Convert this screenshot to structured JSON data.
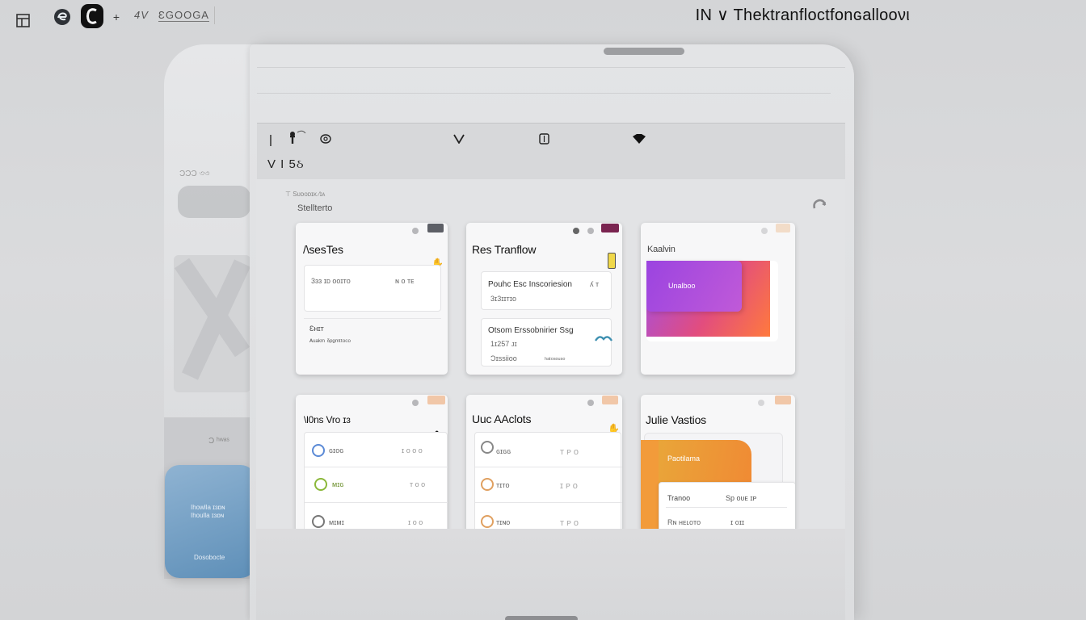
{
  "topbar": {
    "icons": [
      "grid-app-icon",
      "edge-browser-icon",
      "c-logo-icon",
      "add-icon",
      "signal-icon"
    ],
    "status_text": "4V",
    "status_code": "ƐGOOGA",
    "title": "IN ∨ Thektranfloctfonɢallooνι"
  },
  "ghost": {
    "label1": "ƆƆƆ ৩৩",
    "label2": "Ɔ  ʰʷᵃˢ",
    "blue_line1": "Ihowlla ɪɜɒɴ",
    "blue_line2": "Ihoulla ɪɜɒɴ",
    "blue_footer": "Dosobocte"
  },
  "toolbar": {
    "icons": [
      "menu-icon",
      "pin-icon",
      "at-icon",
      "chevron-down-icon",
      "archive-icon",
      "diamond-icon"
    ],
    "view_label": "V I 5ઠ"
  },
  "breadcrumb": "⊤ Sᴜᴅᴏᴅɪᴋ ⁄ɪᴀ",
  "section_title": "Stellterto",
  "cards": [
    {
      "title": "/\\sesTes",
      "tag_color": "#5d5f66",
      "rows": [
        "3ɜɜ ɪᴅ ᴏᴏɪᴛᴏ",
        "ɴ  ᴏ ᴛᴇ"
      ],
      "sub_label": "Ɛʜɪᴛ",
      "sub_text": "ᴬᵘᵃᵏᵐ ᵟᵖᵍᵐᵗᵗᵒᶜᵒ"
    },
    {
      "title": "Res Tranflow",
      "tag_color": "#7a2450",
      "panel1_title": "Pouhc Esc Inscoriesion",
      "panel1_val": "3ɪ3ɪɪᴛɪᴏ",
      "panel1_side": "ʎ  ᴛ",
      "panel2_title": "Otsom Erssobnirier Ssg",
      "panel2_val": "1ɪ257  ᴊɪ",
      "panel2_foot": "Ɔɪssiioᴏ",
      "panel2_side": "ʰᵃᵗᵒˢᵒᵘˢᵒ"
    },
    {
      "title": "Kaalvin",
      "tag_color": "#f2dcc8",
      "chip_label": "Unalboo"
    },
    {
      "title": "\\l0ns Vro ɪɜ",
      "tag_color": "#f1c7a8",
      "rows": [
        {
          "icon_color": "#5b8ad6",
          "label": "ɢɪᴏɢ",
          "value": "ɪ  ᴏ  ᴏ ᴏ"
        },
        {
          "icon_color": "#8bb83a",
          "label": "ᴍɪɢ",
          "value": "ᴛ ᴏ ᴏ"
        },
        {
          "icon_color": "#777777",
          "label": "ᴍɪᴍɪ",
          "value": "ɪ ᴏ ᴏ"
        }
      ]
    },
    {
      "title": "Uuc AAclots",
      "tag_color": "#f1c7a8",
      "rows": [
        {
          "icon_color": "#888888",
          "label": "ɢɪɢɢ",
          "value": "ᴛ  ᴘ  ᴏ"
        },
        {
          "icon_color": "#e0a060",
          "label": "ᴛɪᴛᴏ",
          "value": "ɪ  ᴘ  ᴏ"
        },
        {
          "icon_color": "#e0a060",
          "label": "ᴛɪɴᴏ",
          "value": "ᴛ  ᴘ  ᴏ"
        }
      ]
    },
    {
      "title": "Julie Vastios",
      "tag_color": "#f1c7a8",
      "chip_label": "Paotilama",
      "panel_title": "Tranoo",
      "panel_side": "Sp ᴏᴜᴇ ɪᴘ",
      "panel_row": "Rɴ ʜᴇʟᴏᴛᴏ",
      "panel_row_side": "ɪ ᴏɪɪ"
    }
  ],
  "colors": {
    "accent_gradient_start": "#a14ee6",
    "accent_gradient_end": "#ff7a3d",
    "orange": "#f2a33a"
  }
}
